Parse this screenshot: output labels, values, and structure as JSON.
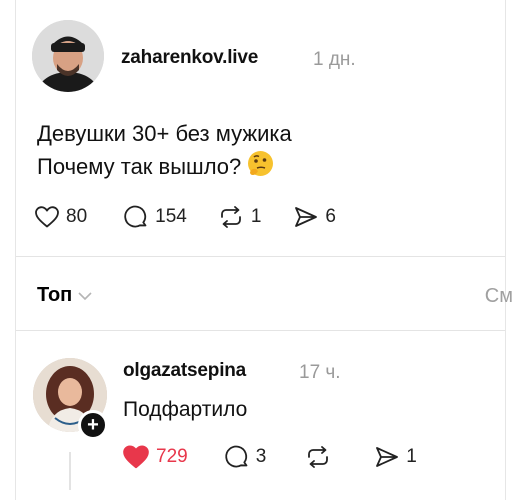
{
  "post": {
    "username": "zaharenkov.live",
    "time": "1 дн.",
    "text_line1": "Девушки 30+ без мужика",
    "text_line2": "Почему так вышло?",
    "emoji": "thinking-face-emoji",
    "likes": "80",
    "comments": "154",
    "reposts": "1",
    "shares": "6"
  },
  "replies": {
    "sort_label": "Топ",
    "see_all_label": "См"
  },
  "comment": {
    "username": "olgazatsepina",
    "time": "17 ч.",
    "text": "Подфартило",
    "follow_symbol": "+",
    "likes": "729",
    "comments": "3",
    "shares": "1",
    "liked": true
  },
  "colors": {
    "like_active": "#e8374b",
    "muted": "#9a9a9a"
  }
}
